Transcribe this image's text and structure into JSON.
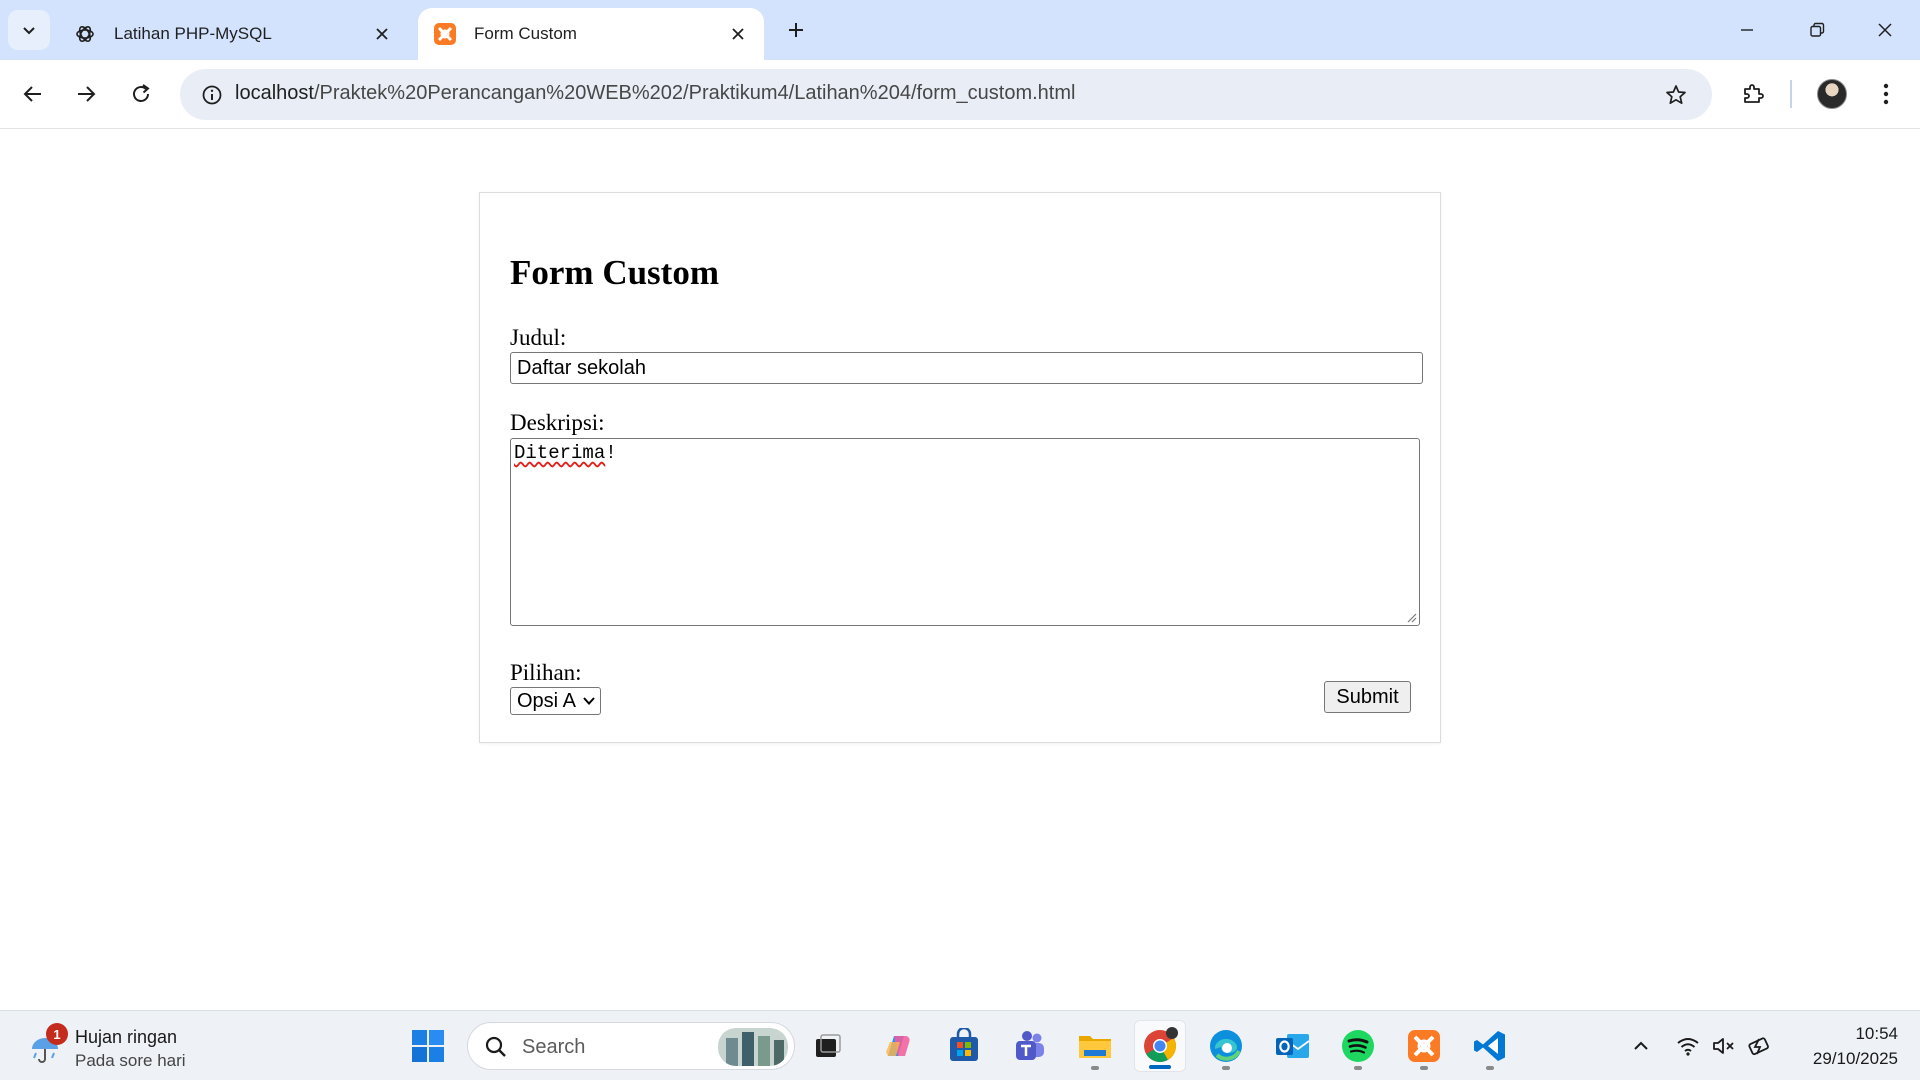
{
  "browser": {
    "tabs": [
      {
        "title": "Latihan PHP-MySQL",
        "icon": "openai-icon",
        "active": false
      },
      {
        "title": "Form Custom",
        "icon": "xampp-icon",
        "active": true
      }
    ],
    "address": {
      "host": "localhost",
      "path": "/Praktek%20Perancangan%20WEB%202/Praktikum4/Latihan%204/form_custom.html"
    }
  },
  "form": {
    "title": "Form Custom",
    "judul_label": "Judul:",
    "judul_value": "Daftar sekolah",
    "deskripsi_label": "Deskripsi:",
    "deskripsi_word": "Diterima",
    "deskripsi_punct": "!",
    "pilihan_label": "Pilihan:",
    "pilihan_selected": "Opsi A",
    "submit_label": "Submit"
  },
  "taskbar": {
    "weather_badge": "1",
    "weather_title": "Hujan ringan",
    "weather_subtitle": "Pada sore hari",
    "search_placeholder": "Search",
    "time": "10:54",
    "date": "29/10/2025",
    "apps": [
      "start",
      "search",
      "task-view",
      "copilot",
      "microsoft-store",
      "teams",
      "file-explorer",
      "chrome",
      "edge",
      "outlook",
      "spotify",
      "xampp",
      "vscode"
    ]
  },
  "colors": {
    "tabstrip": "#d3e3fd",
    "omnibox": "#e9eef6",
    "xampp_orange": "#fb7a24",
    "accent_blue": "#0067c0",
    "spell_error": "#e0201c"
  }
}
